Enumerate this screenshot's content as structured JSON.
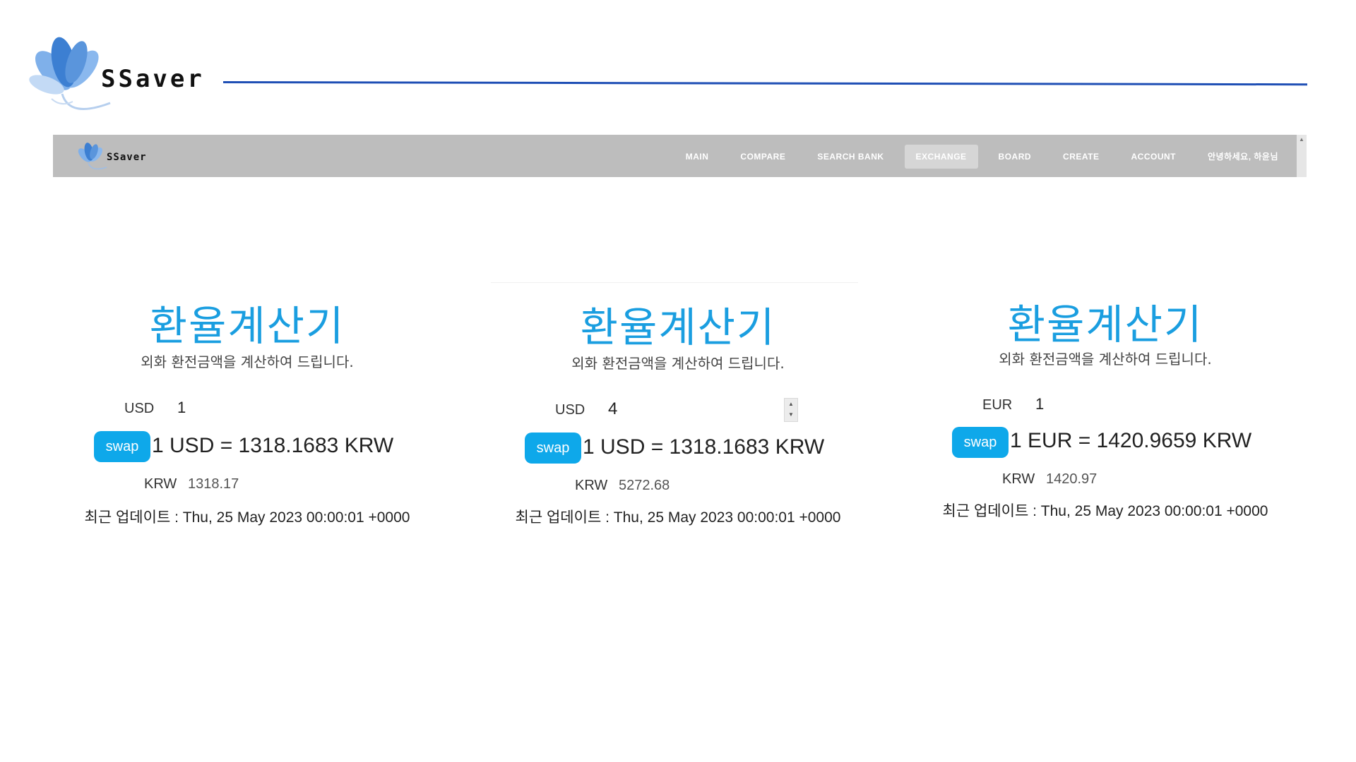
{
  "brand": {
    "name": "SSaver"
  },
  "navbar": {
    "logo_text": "SSaver",
    "items": [
      "MAIN",
      "COMPARE",
      "SEARCH BANK",
      "EXCHANGE",
      "BOARD",
      "CREATE",
      "ACCOUNT",
      "안녕하세요, 하윤님"
    ],
    "active": "EXCHANGE"
  },
  "calculators": [
    {
      "title": "환율계산기",
      "subtitle": "외화 환전금액을 계산하여 드립니다.",
      "from_currency": "USD",
      "amount": "1",
      "swap_label": "swap",
      "rate_text": "1 USD = 1318.1683 KRW",
      "to_currency": "KRW",
      "result": "1318.17",
      "updated_prefix": "최근 업데이트 :",
      "updated_time": "Thu, 25 May 2023 00:00:01 +0000"
    },
    {
      "title": "환율계산기",
      "subtitle": "외화 환전금액을 계산하여 드립니다.",
      "from_currency": "USD",
      "amount": "4",
      "swap_label": "swap",
      "rate_text": "1 USD = 1318.1683 KRW",
      "to_currency": "KRW",
      "result": "5272.68",
      "updated_prefix": "최근 업데이트 :",
      "updated_time": "Thu, 25 May 2023 00:00:01 +0000"
    },
    {
      "title": "환율계산기",
      "subtitle": "외화 환전금액을 계산하여 드립니다.",
      "from_currency": "EUR",
      "amount": "1",
      "swap_label": "swap",
      "rate_text": "1 EUR = 1420.9659 KRW",
      "to_currency": "KRW",
      "result": "1420.97",
      "updated_prefix": "최근 업데이트 :",
      "updated_time": "Thu, 25 May 2023 00:00:01 +0000"
    }
  ],
  "colors": {
    "accent_blue": "#1a9ee0",
    "swap_button": "#0ea8ea",
    "header_line": "#1f4fb5",
    "navbar_bg": "#bdbdbd"
  }
}
